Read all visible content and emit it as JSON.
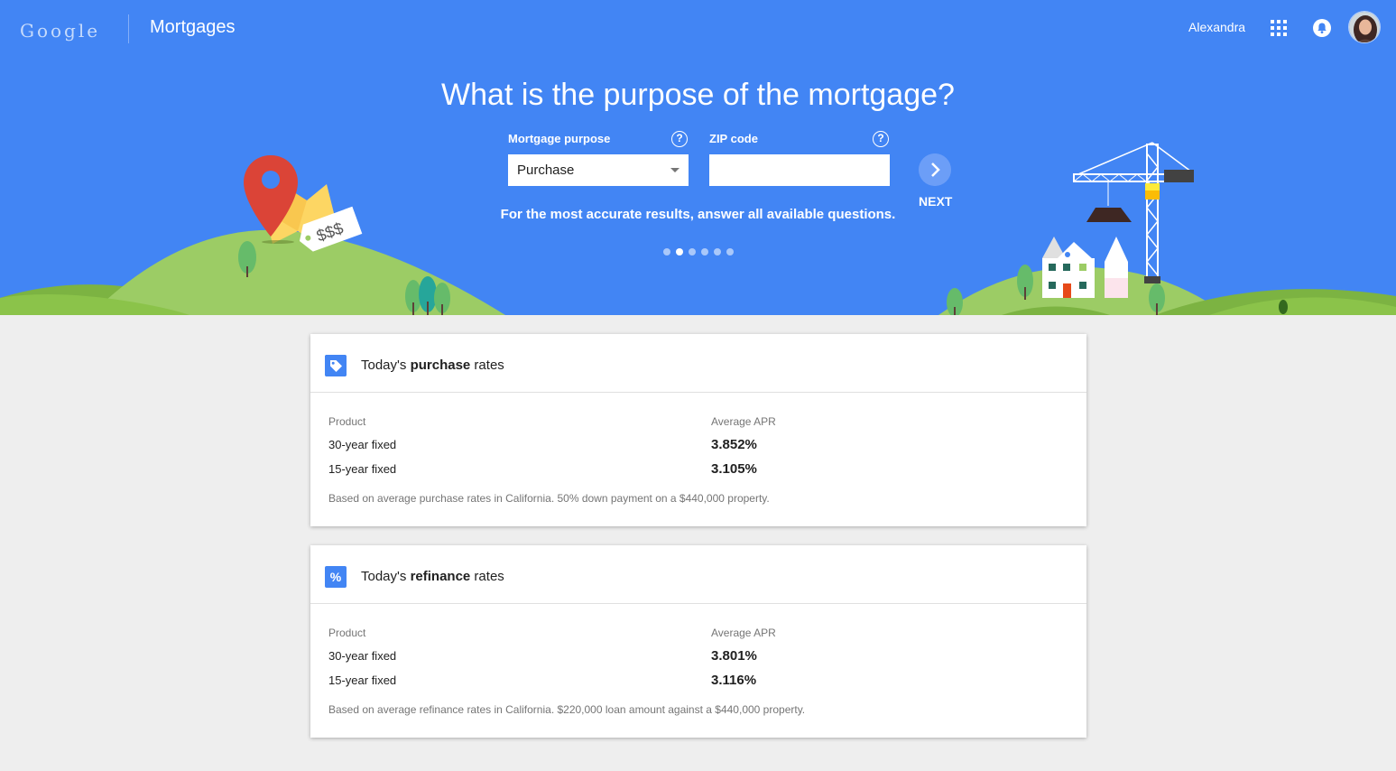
{
  "header": {
    "logo_text": "Google",
    "app_title": "Mortgages",
    "user_name": "Alexandra"
  },
  "hero": {
    "headline": "What is the purpose of the mortgage?",
    "purpose_label": "Mortgage purpose",
    "purpose_value": "Purchase",
    "zip_label": "ZIP code",
    "zip_value": "",
    "next_label": "NEXT",
    "hint": "For the most accurate results, answer all available questions.",
    "help_glyph": "?",
    "price_tag_text": "$$$",
    "steps_total": 6,
    "current_step": 2
  },
  "purchase": {
    "icon_glyph": "",
    "title_prefix": "Today's ",
    "title_bold": "purchase",
    "title_suffix": " rates",
    "col_product": "Product",
    "col_apr": "Average APR",
    "rows": [
      {
        "product": "30-year fixed",
        "apr": "3.852%"
      },
      {
        "product": "15-year fixed",
        "apr": "3.105%"
      }
    ],
    "footnote": "Based on average purchase rates in California. 50% down payment on a $440,000 property."
  },
  "refinance": {
    "icon_glyph": "%",
    "title_prefix": "Today's ",
    "title_bold": "refinance",
    "title_suffix": " rates",
    "col_product": "Product",
    "col_apr": "Average APR",
    "rows": [
      {
        "product": "30-year fixed",
        "apr": "3.801%"
      },
      {
        "product": "15-year fixed",
        "apr": "3.116%"
      }
    ],
    "footnote": "Based on average refinance rates in California. $220,000 loan amount against a $440,000 property."
  },
  "colors": {
    "hero_blue": "#4285f4",
    "hill_green": "#8bc34a",
    "pin_red": "#db4437",
    "page_bg": "#eeeeee"
  },
  "icons": {
    "apps": "apps-grid-icon",
    "bell": "notifications-bell-icon",
    "help": "help-circle-icon",
    "next": "chevron-right-icon",
    "tag": "price-tag-icon",
    "percent": "percent-icon",
    "dropdown": "dropdown-caret-icon"
  }
}
